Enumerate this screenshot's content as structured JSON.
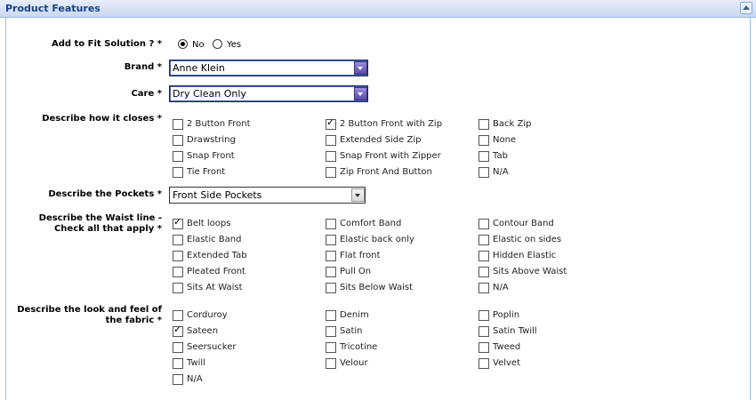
{
  "panel": {
    "title": "Product Features"
  },
  "fit": {
    "label": "Add to Fit Solution ?",
    "options": [
      {
        "label": "No",
        "selected": true
      },
      {
        "label": "Yes",
        "selected": false
      }
    ]
  },
  "brand": {
    "label": "Brand",
    "value": "Anne Klein"
  },
  "care": {
    "label": "Care",
    "value": "Dry Clean Only"
  },
  "closes": {
    "label": "Describe how it closes",
    "options": [
      {
        "label": "2 Button Front",
        "checked": false
      },
      {
        "label": "2 Button Front with Zip",
        "checked": true
      },
      {
        "label": "Back Zip",
        "checked": false
      },
      {
        "label": "Drawstring",
        "checked": false
      },
      {
        "label": "Extended Side Zip",
        "checked": false
      },
      {
        "label": "None",
        "checked": false
      },
      {
        "label": "Snap Front",
        "checked": false
      },
      {
        "label": "Snap Front with Zipper",
        "checked": false
      },
      {
        "label": "Tab",
        "checked": false
      },
      {
        "label": "Tie Front",
        "checked": false
      },
      {
        "label": "Zip Front And Button",
        "checked": false
      },
      {
        "label": "N/A",
        "checked": false
      }
    ]
  },
  "pockets": {
    "label": "Describe the Pockets",
    "value": "Front Side Pockets"
  },
  "waist": {
    "label_line1": "Describe the Waist line -",
    "label_line2": "Check all that apply",
    "options": [
      {
        "label": "Belt loops",
        "checked": true
      },
      {
        "label": "Comfort Band",
        "checked": false
      },
      {
        "label": "Contour Band",
        "checked": false
      },
      {
        "label": "Elastic Band",
        "checked": false
      },
      {
        "label": "Elastic back only",
        "checked": false
      },
      {
        "label": "Elastic on sides",
        "checked": false
      },
      {
        "label": "Extended Tab",
        "checked": false
      },
      {
        "label": "Flat front",
        "checked": false
      },
      {
        "label": "Hidden Elastic",
        "checked": false
      },
      {
        "label": "Pleated Front",
        "checked": false
      },
      {
        "label": "Pull On",
        "checked": false
      },
      {
        "label": "Sits Above Waist",
        "checked": false
      },
      {
        "label": "Sits At Waist",
        "checked": false
      },
      {
        "label": "Sits Below Waist",
        "checked": false
      },
      {
        "label": "N/A",
        "checked": false
      }
    ]
  },
  "fabric": {
    "label_line1": "Describe the look and feel of",
    "label_line2": "the fabric",
    "options": [
      {
        "label": "Corduroy",
        "checked": false
      },
      {
        "label": "Denim",
        "checked": false
      },
      {
        "label": "Poplin",
        "checked": false
      },
      {
        "label": "Sateen",
        "checked": true
      },
      {
        "label": "Satin",
        "checked": false
      },
      {
        "label": "Satin Twill",
        "checked": false
      },
      {
        "label": "Seersucker",
        "checked": false
      },
      {
        "label": "Tricotine",
        "checked": false
      },
      {
        "label": "Tweed",
        "checked": false
      },
      {
        "label": "Twill",
        "checked": false
      },
      {
        "label": "Velour",
        "checked": false
      },
      {
        "label": "Velvet",
        "checked": false
      },
      {
        "label": "N/A",
        "checked": false
      }
    ]
  },
  "required_mark": "*"
}
